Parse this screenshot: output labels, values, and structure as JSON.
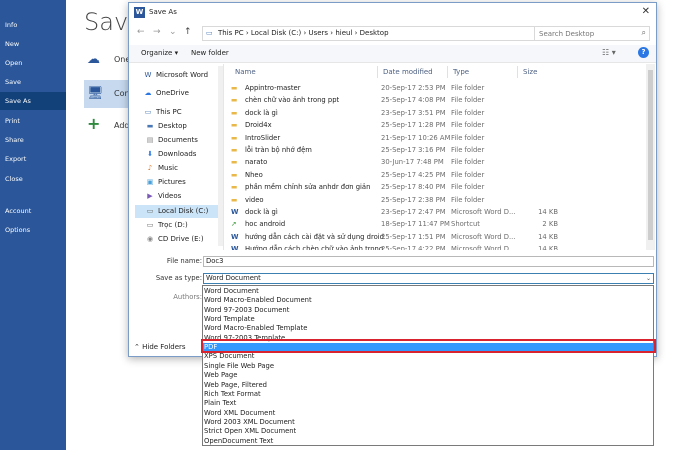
{
  "backstage": {
    "menu": [
      {
        "label": "Info",
        "active": false
      },
      {
        "label": "New",
        "active": false
      },
      {
        "label": "Open",
        "active": false
      },
      {
        "label": "Save",
        "active": false
      },
      {
        "label": "Save As",
        "active": true
      },
      {
        "label": "Print",
        "active": false
      },
      {
        "label": "Share",
        "active": false
      },
      {
        "label": "Export",
        "active": false
      },
      {
        "label": "Close",
        "active": false
      },
      {
        "label": "Account",
        "active": false
      },
      {
        "label": "Options",
        "active": false
      }
    ],
    "title": "Save",
    "places": [
      {
        "label": "One",
        "icon": "cloud-icon"
      },
      {
        "label": "Con",
        "icon": "computer-icon"
      },
      {
        "label": "Add",
        "icon": "plus-icon"
      }
    ]
  },
  "dialog": {
    "title": "Save As",
    "address": {
      "crumbs": "This PC  ›  Local Disk (C:)  ›  Users  ›  hieul  ›  Desktop",
      "search_placeholder": "Search Desktop"
    },
    "toolbar": {
      "organize": "Organize ▾",
      "new_folder": "New folder"
    },
    "nav": [
      {
        "label": "Microsoft Word",
        "icon": "word-icon",
        "indent": 0,
        "selected": false
      },
      {
        "label": "OneDrive",
        "icon": "cloud-icon",
        "indent": 0,
        "selected": false
      },
      {
        "label": "This PC",
        "icon": "computer-icon",
        "indent": 0,
        "selected": false
      },
      {
        "label": "Desktop",
        "icon": "desktop-icon",
        "indent": 1,
        "selected": false
      },
      {
        "label": "Documents",
        "icon": "documents-icon",
        "indent": 1,
        "selected": false
      },
      {
        "label": "Downloads",
        "icon": "downloads-icon",
        "indent": 1,
        "selected": false
      },
      {
        "label": "Music",
        "icon": "music-icon",
        "indent": 1,
        "selected": false
      },
      {
        "label": "Pictures",
        "icon": "pictures-icon",
        "indent": 1,
        "selected": false
      },
      {
        "label": "Videos",
        "icon": "videos-icon",
        "indent": 1,
        "selected": false
      },
      {
        "label": "Local Disk (C:)",
        "icon": "drive-icon",
        "indent": 1,
        "selected": true
      },
      {
        "label": "Trọc (D:)",
        "icon": "drive-icon",
        "indent": 1,
        "selected": false
      },
      {
        "label": "CD Drive (E:)",
        "icon": "cd-icon",
        "indent": 1,
        "selected": false
      }
    ],
    "columns": {
      "name": "Name",
      "date": "Date modified",
      "type": "Type",
      "size": "Size"
    },
    "files": [
      {
        "name": "Appintro-master",
        "date": "20-Sep-17 2:53 PM",
        "type": "File folder",
        "size": "",
        "kind": "folder"
      },
      {
        "name": "chèn chữ vào ảnh trong ppt",
        "date": "25-Sep-17 4:08 PM",
        "type": "File folder",
        "size": "",
        "kind": "folder"
      },
      {
        "name": "dock là gì",
        "date": "23-Sep-17 3:51 PM",
        "type": "File folder",
        "size": "",
        "kind": "folder"
      },
      {
        "name": "Droid4x",
        "date": "25-Sep-17 1:28 PM",
        "type": "File folder",
        "size": "",
        "kind": "folder"
      },
      {
        "name": "IntroSlider",
        "date": "21-Sep-17 10:26 AM",
        "type": "File folder",
        "size": "",
        "kind": "folder"
      },
      {
        "name": "lỗi tràn bộ nhớ đệm",
        "date": "25-Sep-17 3:16 PM",
        "type": "File folder",
        "size": "",
        "kind": "folder"
      },
      {
        "name": "narato",
        "date": "30-Jun-17 7:48 PM",
        "type": "File folder",
        "size": "",
        "kind": "folder"
      },
      {
        "name": "Nheo",
        "date": "25-Sep-17 4:25 PM",
        "type": "File folder",
        "size": "",
        "kind": "folder"
      },
      {
        "name": "phần mềm chỉnh sửa anhdr đơn giản",
        "date": "25-Sep-17 8:40 PM",
        "type": "File folder",
        "size": "",
        "kind": "folder"
      },
      {
        "name": "video",
        "date": "25-Sep-17 2:38 PM",
        "type": "File folder",
        "size": "",
        "kind": "folder"
      },
      {
        "name": "dock là gì",
        "date": "23-Sep-17 2:47 PM",
        "type": "Microsoft Word D...",
        "size": "14 KB",
        "kind": "word"
      },
      {
        "name": "hoc android",
        "date": "18-Sep-17 11:47 PM",
        "type": "Shortcut",
        "size": "2 KB",
        "kind": "shortcut"
      },
      {
        "name": "hướng dẫn cách cài đặt và sử dụng droid...",
        "date": "25-Sep-17 1:51 PM",
        "type": "Microsoft Word D...",
        "size": "14 KB",
        "kind": "word"
      },
      {
        "name": "Hướng dẫn cách chèn chữ vào ảnh trong...",
        "date": "25-Sep-17 4:22 PM",
        "type": "Microsoft Word D...",
        "size": "14 KB",
        "kind": "word"
      }
    ],
    "file_name_label": "File name:",
    "file_name": "Doc3",
    "save_type_label": "Save as type:",
    "save_type": "Word Document",
    "authors_label": "Authors:",
    "hide_folders": "Hide Folders",
    "type_options": [
      "Word Document",
      "Word Macro-Enabled Document",
      "Word 97-2003 Document",
      "Word Template",
      "Word Macro-Enabled Template",
      "Word 97-2003 Template",
      "PDF",
      "XPS Document",
      "Single File Web Page",
      "Web Page",
      "Web Page, Filtered",
      "Rich Text Format",
      "Plain Text",
      "Word XML Document",
      "Word 2003 XML Document",
      "Strict Open XML Document",
      "OpenDocument Text"
    ],
    "highlighted_option": "PDF",
    "colors": {
      "accent": "#2b579a",
      "highlight": "#3399ff",
      "annotation": "#d9232e"
    }
  }
}
